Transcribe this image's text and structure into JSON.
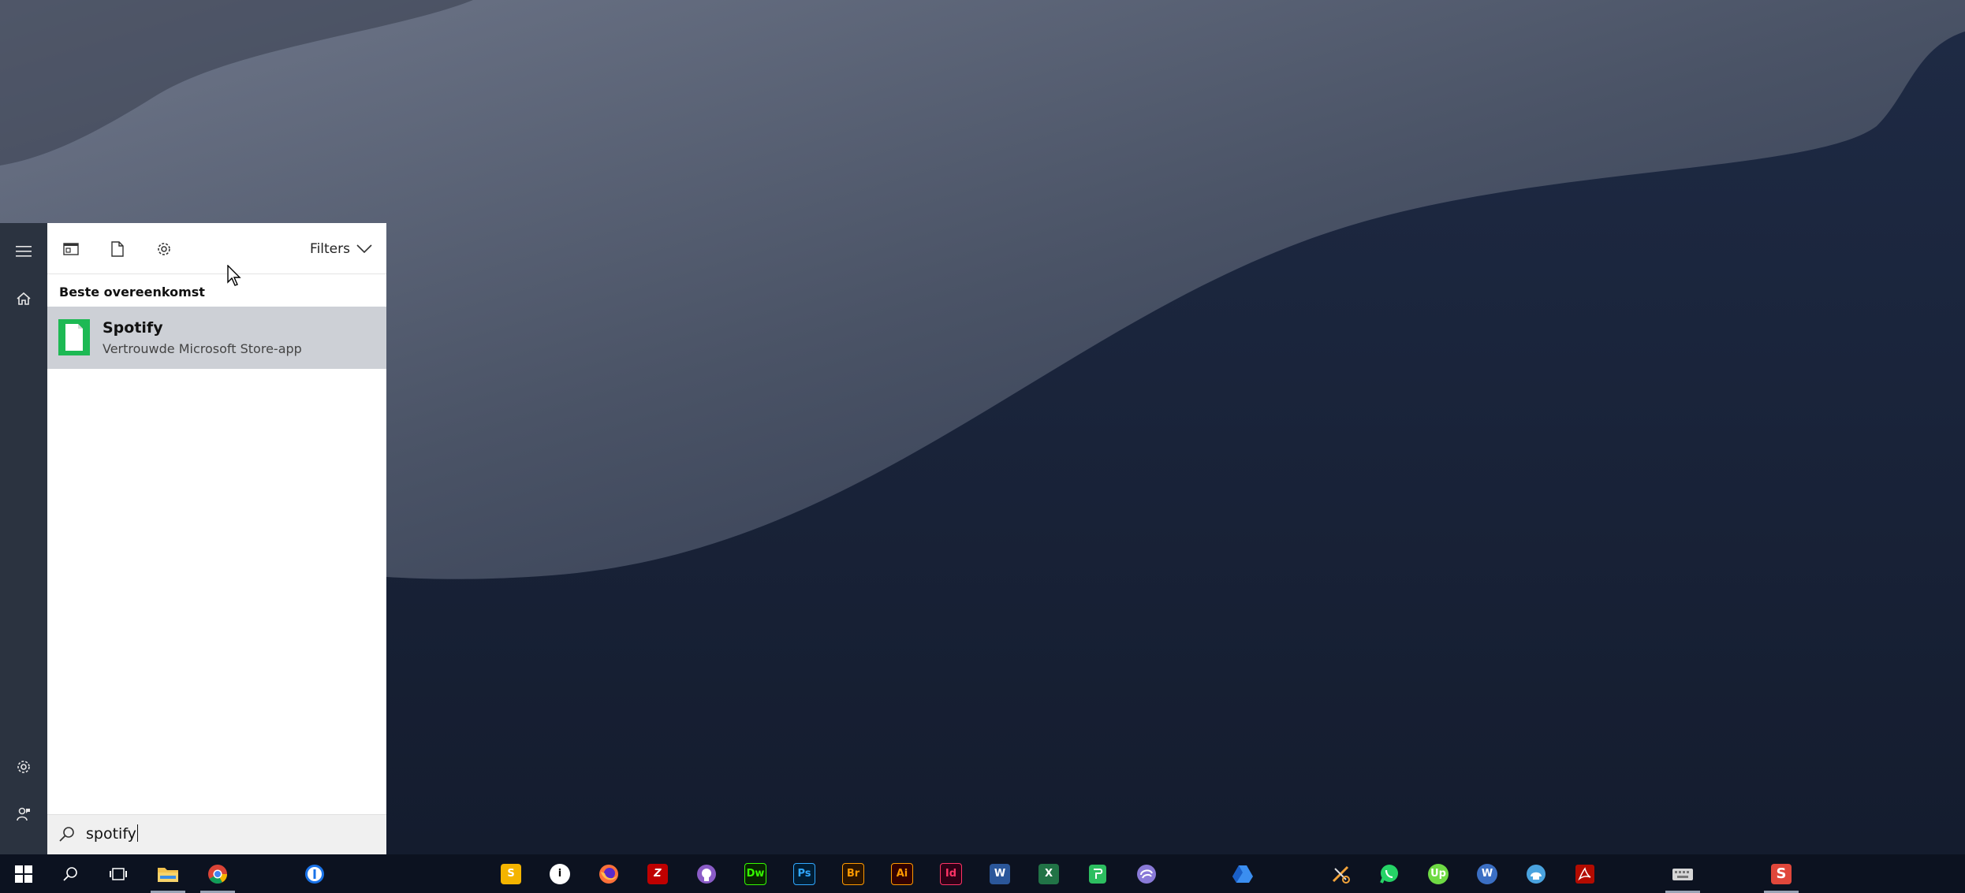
{
  "start_menu": {
    "rail": {
      "menu_icon": "hamburger-menu-icon",
      "home_icon": "home-icon",
      "settings_icon": "gear-icon",
      "feedback_icon": "person-feedback-icon"
    },
    "top_bar": {
      "apps_icon": "apps-window-icon",
      "documents_icon": "document-icon",
      "settings_icon": "gear-icon",
      "filters_label": "Filters"
    },
    "section_label": "Beste overeenkomst",
    "best_match": {
      "title": "Spotify",
      "subtitle": "Vertrouwde Microsoft Store-app",
      "icon": "spotify-app-icon",
      "highlight_color": "#cdd0d6"
    },
    "search": {
      "value": "spotify",
      "icon": "search-icon"
    }
  },
  "taskbar": {
    "background": "#0c1220",
    "items": [
      {
        "name": "windows-start-icon",
        "label": ""
      },
      {
        "name": "search-icon",
        "label": ""
      },
      {
        "name": "task-view-icon",
        "label": ""
      },
      {
        "name": "file-explorer-icon",
        "label": ""
      },
      {
        "name": "chrome-icon",
        "label": ""
      },
      {
        "name": "1password-icon",
        "label": ""
      },
      {
        "name": "slides-icon",
        "label": "S"
      },
      {
        "name": "info-icon",
        "label": "i"
      },
      {
        "name": "firefox-icon",
        "label": ""
      },
      {
        "name": "filezilla-icon",
        "label": "Z"
      },
      {
        "name": "github-icon",
        "label": ""
      },
      {
        "name": "dreamweaver-icon",
        "label": "Dw"
      },
      {
        "name": "photoshop-icon",
        "label": "Ps"
      },
      {
        "name": "bridge-icon",
        "label": "Br"
      },
      {
        "name": "illustrator-icon",
        "label": "Ai"
      },
      {
        "name": "indesign-icon",
        "label": "Id"
      },
      {
        "name": "word-icon",
        "label": "W"
      },
      {
        "name": "excel-icon",
        "label": "X"
      },
      {
        "name": "evernote-icon",
        "label": ""
      },
      {
        "name": "torrent-icon",
        "label": ""
      },
      {
        "name": "drive-icon",
        "label": ""
      },
      {
        "name": "clipping-tool-icon",
        "label": ""
      },
      {
        "name": "whatsapp-icon",
        "label": ""
      },
      {
        "name": "upwork-icon",
        "label": "Up"
      },
      {
        "name": "wordpress-icon",
        "label": "W"
      },
      {
        "name": "mindnode-icon",
        "label": ""
      },
      {
        "name": "acrobat-icon",
        "label": ""
      },
      {
        "name": "keyboard-icon",
        "label": ""
      },
      {
        "name": "smartgit-icon",
        "label": "S"
      }
    ]
  }
}
